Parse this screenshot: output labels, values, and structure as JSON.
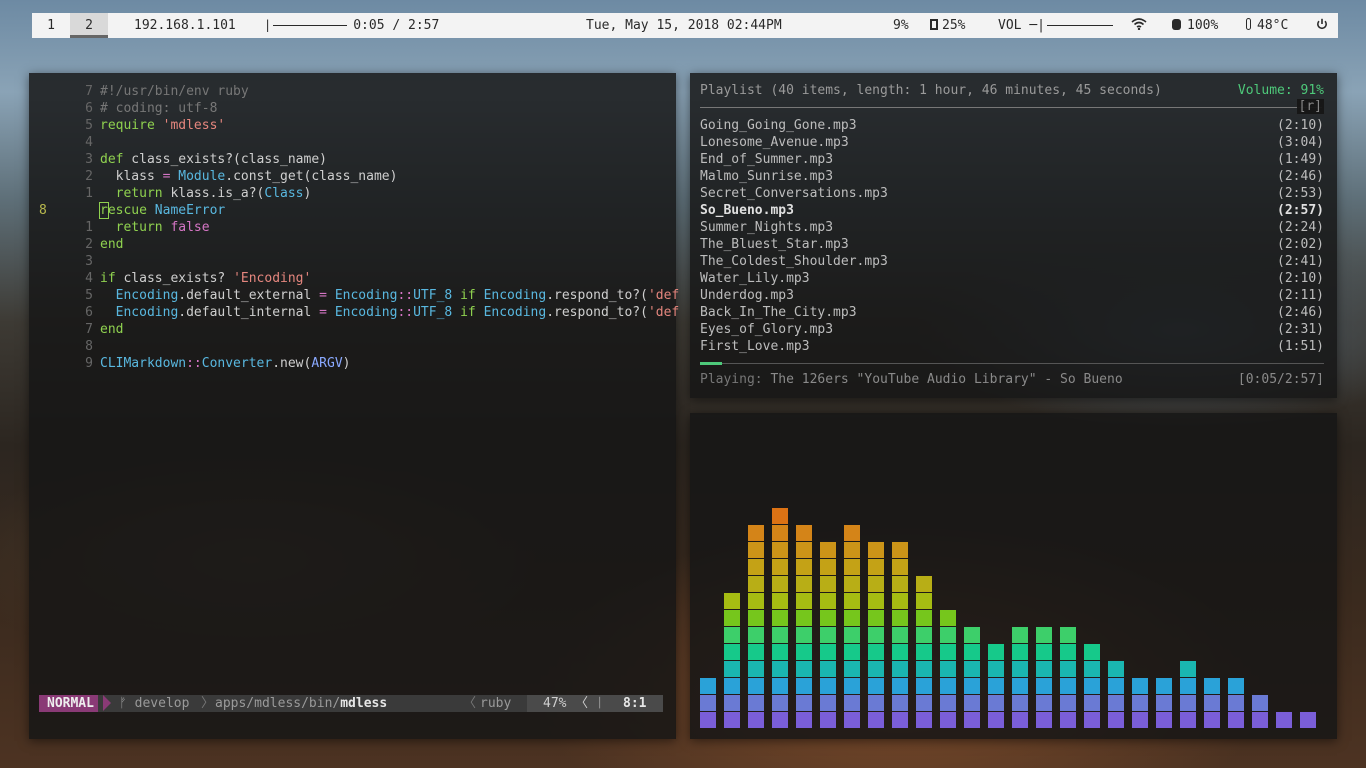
{
  "topbar": {
    "workspaces": [
      "1",
      "2"
    ],
    "active_workspace": "2",
    "ip": "192.168.1.101",
    "seek_time": "0:05 / 2:57",
    "datetime": "Tue, May 15, 2018 02:44PM",
    "cpu": "9%",
    "memory": "25%",
    "vol_label": "VOL",
    "battery": "100%",
    "temperature": "48°C",
    "icons": [
      "memory-chip-icon",
      "wifi-icon",
      "battery-icon",
      "thermometer-icon",
      "power-icon"
    ]
  },
  "editor": {
    "line_numbers": [
      "7",
      "6",
      "5",
      "4",
      "3",
      "2",
      "1",
      "8",
      "1",
      "2",
      "3",
      "4",
      "5",
      "6",
      "7",
      "8",
      "9"
    ],
    "cursor_line_index": 7,
    "statusline": {
      "mode": "NORMAL",
      "branch_symbol": "ᚠ",
      "branch": "develop",
      "path": "apps/mdless/bin/",
      "file": "mdless",
      "filetype": "ruby",
      "percent": "47%",
      "lock_glyph": "ᛁ",
      "position": "8:1"
    }
  },
  "playlist": {
    "header": "Playlist (40 items, length: 1 hour, 46 minutes, 45 seconds)",
    "volume": "Volume: 91%",
    "repeat_flag": "[r]",
    "tracks": [
      {
        "title": "Going_Going_Gone.mp3",
        "duration": "(2:10)"
      },
      {
        "title": "Lonesome_Avenue.mp3",
        "duration": "(3:04)"
      },
      {
        "title": "End_of_Summer.mp3",
        "duration": "(1:49)"
      },
      {
        "title": "Malmo_Sunrise.mp3",
        "duration": "(2:46)"
      },
      {
        "title": "Secret_Conversations.mp3",
        "duration": "(2:53)"
      },
      {
        "title": "So_Bueno.mp3",
        "duration": "(2:57)"
      },
      {
        "title": "Summer_Nights.mp3",
        "duration": "(2:24)"
      },
      {
        "title": "The_Bluest_Star.mp3",
        "duration": "(2:02)"
      },
      {
        "title": "The_Coldest_Shoulder.mp3",
        "duration": "(2:41)"
      },
      {
        "title": "Water_Lily.mp3",
        "duration": "(2:10)"
      },
      {
        "title": "Underdog.mp3",
        "duration": "(2:11)"
      },
      {
        "title": "Back_In_The_City.mp3",
        "duration": "(2:46)"
      },
      {
        "title": "Eyes_of_Glory.mp3",
        "duration": "(2:31)"
      },
      {
        "title": "First_Love.mp3",
        "duration": "(1:51)"
      }
    ],
    "selected_index": 5,
    "progress_fraction": 0.035,
    "playing_label": "Playing:",
    "playing_text": "The 126ers \"YouTube Audio Library\" - So Bueno",
    "playing_time": "[0:05/2:57]"
  },
  "visualizer": {
    "bar_levels": [
      3,
      8,
      12,
      13,
      12,
      11,
      12,
      11,
      11,
      9,
      7,
      6,
      5,
      6,
      6,
      6,
      5,
      4,
      3,
      3,
      4,
      3,
      3,
      2,
      1,
      1
    ],
    "max_level": 13,
    "level_colors": [
      "#7a5ed8",
      "#6a7ad4",
      "#2aa2d8",
      "#1ab6b0",
      "#16c98a",
      "#3dcf6a",
      "#76c61c",
      "#a6bc12",
      "#b8ae16",
      "#c4a216",
      "#cc9418",
      "#d48418",
      "#dc7214"
    ]
  }
}
